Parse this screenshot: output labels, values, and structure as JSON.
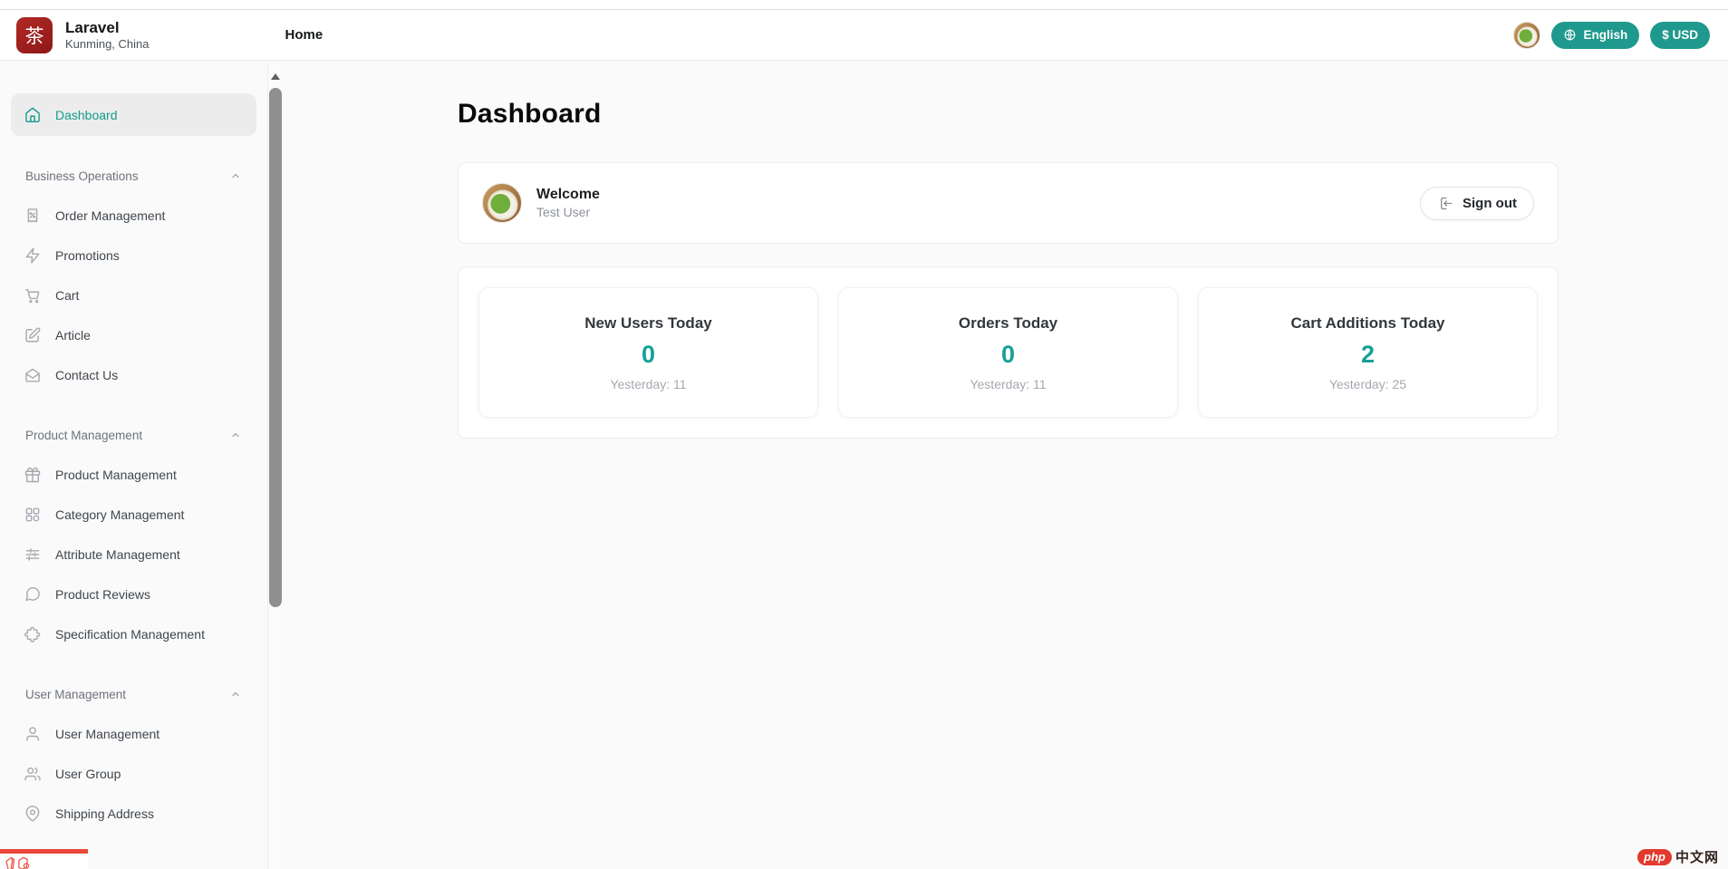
{
  "colors": {
    "accent_teal": "#1f998d",
    "active_teal": "#169b8e",
    "stat_value_teal": "#16a096",
    "logo_red": "#a72422",
    "watermark_red": "#e23a2e"
  },
  "header": {
    "logo_glyph": "茶",
    "brand": "Laravel",
    "location": "Kunming, China",
    "home_tab": "Home",
    "language_label": "English",
    "currency_label": "$ USD"
  },
  "sidebar": {
    "dashboard_label": "Dashboard",
    "sections": [
      {
        "label": "Business Operations",
        "items": [
          {
            "label": "Order Management"
          },
          {
            "label": "Promotions"
          },
          {
            "label": "Cart"
          },
          {
            "label": "Article"
          },
          {
            "label": "Contact Us"
          }
        ]
      },
      {
        "label": "Product Management",
        "items": [
          {
            "label": "Product Management"
          },
          {
            "label": "Category Management"
          },
          {
            "label": "Attribute Management"
          },
          {
            "label": "Product Reviews"
          },
          {
            "label": "Specification Management"
          }
        ]
      },
      {
        "label": "User Management",
        "items": [
          {
            "label": "User Management"
          },
          {
            "label": "User Group"
          },
          {
            "label": "Shipping Address"
          }
        ]
      }
    ]
  },
  "main": {
    "page_title": "Dashboard",
    "welcome_card": {
      "title": "Welcome",
      "username": "Test User",
      "signout_label": "Sign out"
    },
    "stat_cards": [
      {
        "title": "New Users Today",
        "value": "0",
        "yesterday": "Yesterday: 11"
      },
      {
        "title": "Orders Today",
        "value": "0",
        "yesterday": "Yesterday: 11"
      },
      {
        "title": "Cart Additions Today",
        "value": "2",
        "yesterday": "Yesterday: 25"
      }
    ]
  },
  "watermark": {
    "badge": "php",
    "text": "中文网"
  }
}
